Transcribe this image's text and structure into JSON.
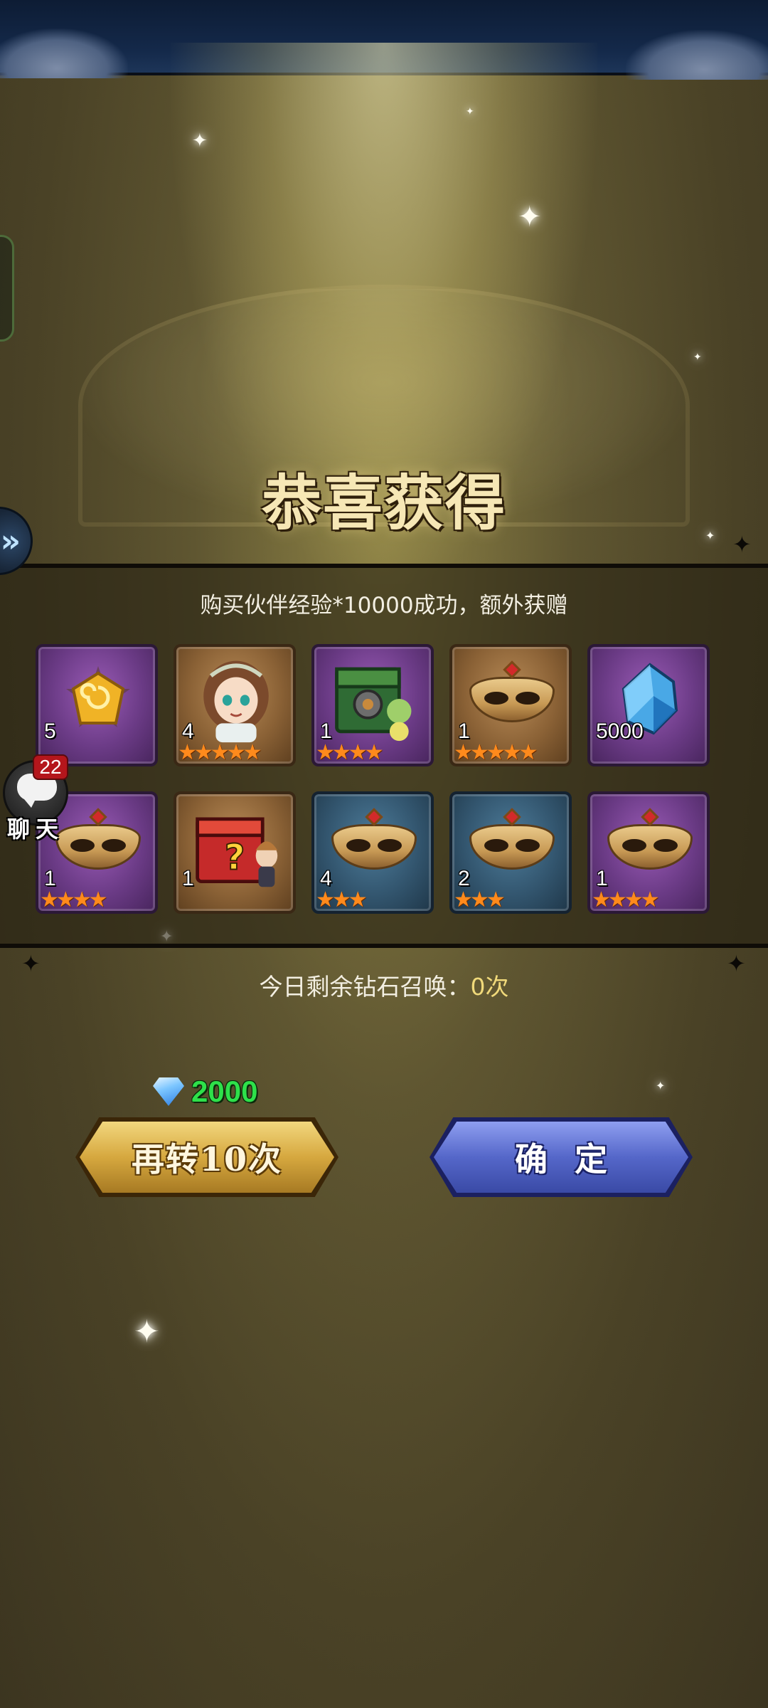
{
  "title": "恭喜获得",
  "subtitle": "购买伙伴经验*10000成功，额外获赠",
  "items": [
    {
      "name": "gold-rune",
      "count": "5",
      "stars": "",
      "bg": "purple"
    },
    {
      "name": "hero-portrait",
      "count": "4",
      "stars": "★★★★★",
      "bg": "orange"
    },
    {
      "name": "green-chest",
      "count": "1",
      "stars": "★★★★",
      "bg": "purple"
    },
    {
      "name": "gold-mask",
      "count": "1",
      "stars": "★★★★★",
      "bg": "orange"
    },
    {
      "name": "blue-crystal",
      "count": "5000",
      "stars": "",
      "bg": "purple"
    },
    {
      "name": "gold-mask",
      "count": "1",
      "stars": "★★★★",
      "bg": "purple"
    },
    {
      "name": "mystery-box",
      "count": "1",
      "stars": "",
      "bg": "orange"
    },
    {
      "name": "gold-mask",
      "count": "4",
      "stars": "★★★",
      "bg": "blue"
    },
    {
      "name": "gold-mask",
      "count": "2",
      "stars": "★★★",
      "bg": "blue"
    },
    {
      "name": "gold-mask",
      "count": "1",
      "stars": "★★★★",
      "bg": "purple"
    }
  ],
  "chat": {
    "label": "聊天",
    "badge": "22"
  },
  "summon": {
    "label": "今日剩余钻石召唤：",
    "count": "0次"
  },
  "cost": {
    "icon": "diamond-icon",
    "value": "2000"
  },
  "buttons": {
    "again": "再转10次",
    "confirm": "确定"
  }
}
